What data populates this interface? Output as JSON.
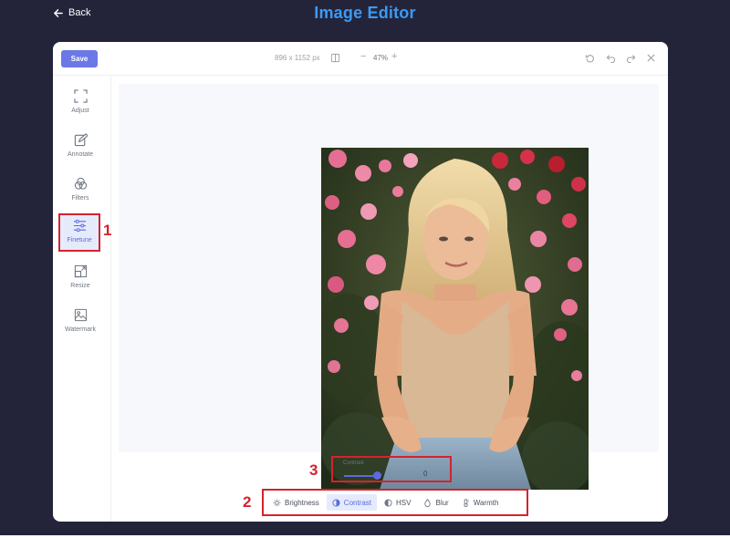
{
  "header": {
    "back_label": "Back",
    "title": "Image Editor"
  },
  "toolbar": {
    "save_label": "Save",
    "dimensions": "896 x 1152 px",
    "zoom_minus": "−",
    "zoom_value": "47%",
    "zoom_plus": "+"
  },
  "sidebar": {
    "items": [
      {
        "label": "Adjust",
        "icon": "crop-icon"
      },
      {
        "label": "Annotate",
        "icon": "pencil-icon"
      },
      {
        "label": "Filters",
        "icon": "filters-icon"
      },
      {
        "label": "Finetune",
        "icon": "sliders-icon",
        "active": true
      },
      {
        "label": "Resize",
        "icon": "resize-icon"
      },
      {
        "label": "Watermark",
        "icon": "image-icon"
      }
    ]
  },
  "finetune": {
    "control_label": "Contrast",
    "value": "0",
    "slider_level": 0.5
  },
  "tabs": [
    {
      "label": "Brightness",
      "icon": "sun-icon"
    },
    {
      "label": "Contrast",
      "icon": "contrast-icon",
      "active": true
    },
    {
      "label": "HSV",
      "icon": "hsv-icon"
    },
    {
      "label": "Blur",
      "icon": "drop-icon"
    },
    {
      "label": "Warmth",
      "icon": "thermometer-icon"
    }
  ],
  "annotations": {
    "marker_1": "1",
    "marker_2": "2",
    "marker_3": "3"
  },
  "colors": {
    "accent": "#5a6be0",
    "title": "#3b9af4",
    "highlight": "#d3242c",
    "background": "#23243a"
  }
}
